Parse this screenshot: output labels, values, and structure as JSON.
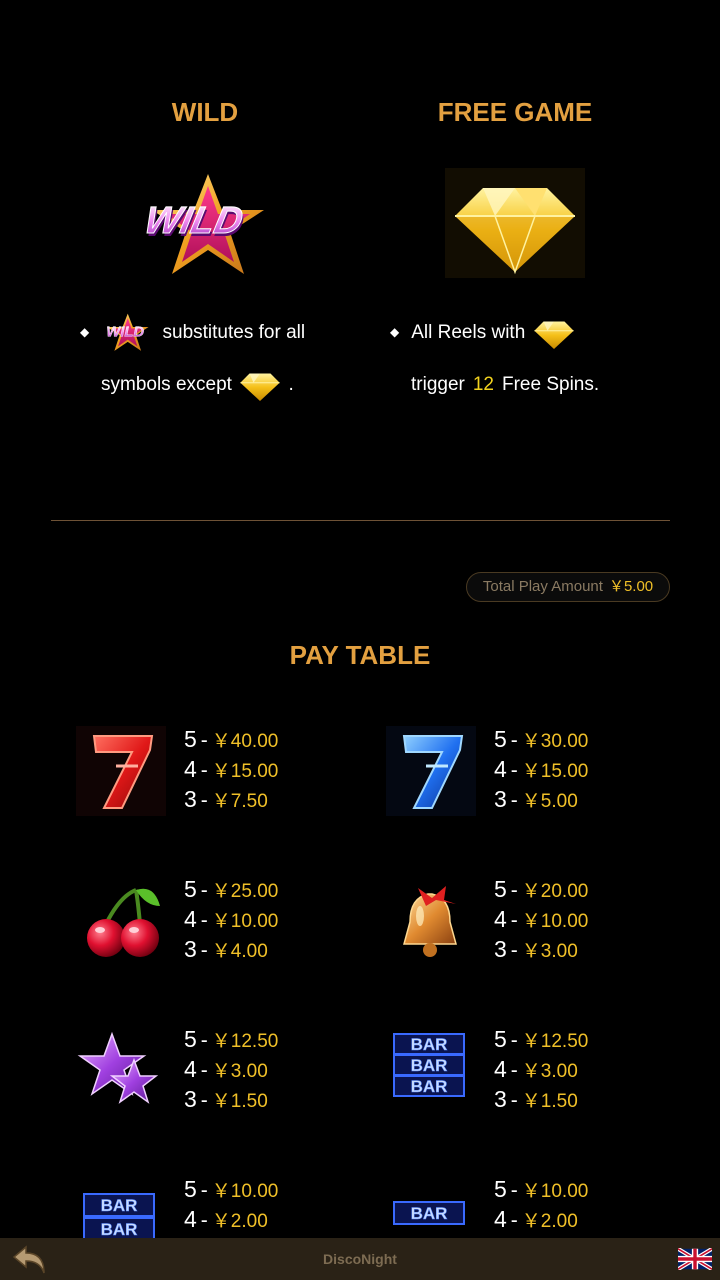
{
  "sections": {
    "wild": {
      "title": "WILD",
      "desc_line1": "substitutes for all",
      "desc_line2_prefix": "symbols except",
      "desc_line2_suffix": ".",
      "icon": "wild-star-icon"
    },
    "free_game": {
      "title": "FREE GAME",
      "desc_line1": "All Reels with",
      "desc_line2_prefix": "trigger",
      "spins": "12",
      "desc_line2_suffix": "Free Spins.",
      "icon": "gold-diamond-icon"
    }
  },
  "total_play": {
    "label": "Total Play Amount",
    "amount": "￥5.00"
  },
  "pay_table": {
    "title": "PAY TABLE",
    "symbols": [
      {
        "icon": "red-seven-icon",
        "pays": [
          {
            "count": "5",
            "value": "￥40.00"
          },
          {
            "count": "4",
            "value": "￥15.00"
          },
          {
            "count": "3",
            "value": "￥7.50"
          }
        ]
      },
      {
        "icon": "blue-seven-icon",
        "pays": [
          {
            "count": "5",
            "value": "￥30.00"
          },
          {
            "count": "4",
            "value": "￥15.00"
          },
          {
            "count": "3",
            "value": "￥5.00"
          }
        ]
      },
      {
        "icon": "cherry-icon",
        "pays": [
          {
            "count": "5",
            "value": "￥25.00"
          },
          {
            "count": "4",
            "value": "￥10.00"
          },
          {
            "count": "3",
            "value": "￥4.00"
          }
        ]
      },
      {
        "icon": "bell-icon",
        "pays": [
          {
            "count": "5",
            "value": "￥20.00"
          },
          {
            "count": "4",
            "value": "￥10.00"
          },
          {
            "count": "3",
            "value": "￥3.00"
          }
        ]
      },
      {
        "icon": "purple-stars-icon",
        "pays": [
          {
            "count": "5",
            "value": "￥12.50"
          },
          {
            "count": "4",
            "value": "￥3.00"
          },
          {
            "count": "3",
            "value": "￥1.50"
          }
        ]
      },
      {
        "icon": "triple-bar-icon",
        "pays": [
          {
            "count": "5",
            "value": "￥12.50"
          },
          {
            "count": "4",
            "value": "￥3.00"
          },
          {
            "count": "3",
            "value": "￥1.50"
          }
        ]
      },
      {
        "icon": "double-bar-icon",
        "pays": [
          {
            "count": "5",
            "value": "￥10.00"
          },
          {
            "count": "4",
            "value": "￥2.00"
          }
        ]
      },
      {
        "icon": "single-bar-icon",
        "pays": [
          {
            "count": "5",
            "value": "￥10.00"
          },
          {
            "count": "4",
            "value": "￥2.00"
          }
        ]
      }
    ],
    "separator": "-",
    "bar_text": "BAR"
  },
  "bottom_bar": {
    "game_name": "DiscoNight",
    "back_icon": "back-arrow-icon",
    "language_icon": "uk-flag-icon"
  },
  "colors": {
    "accent": "#e3a040",
    "value": "#f0c028",
    "highlight": "#f2d21e",
    "bar_bg": "#2a2216"
  }
}
